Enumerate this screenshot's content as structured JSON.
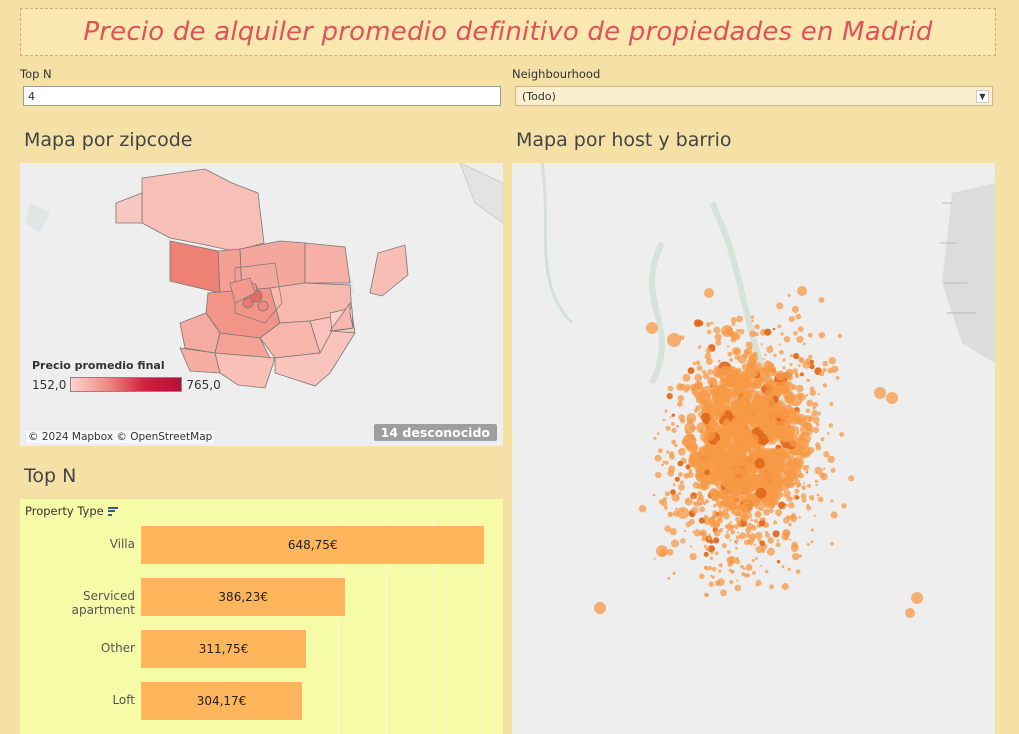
{
  "title": "Precio de alquiler promedio definitivo de propiedades en Madrid",
  "filters": {
    "top_n": {
      "label": "Top N",
      "value": "4"
    },
    "neighbourhood": {
      "label": "Neighbourhood",
      "value": "(Todo)"
    }
  },
  "sections": {
    "zip_map": "Mapa por zipcode",
    "host_map": "Mapa por host y barrio",
    "top_n": "Top N"
  },
  "legend": {
    "title": "Precio promedio final",
    "min": "152,0",
    "max": "765,0"
  },
  "attribution": "© 2024 Mapbox © OpenStreetMap",
  "unknown_badge": "14 desconocido",
  "colors": {
    "background": "#f5e1a6",
    "title": "#e0525b",
    "bar": "#ffb55c",
    "bar_panel": "#f6fba8",
    "dot": "#f79a45"
  },
  "chart_data": {
    "type": "bar",
    "orientation": "horizontal",
    "dimension_label": "Property Type",
    "categories": [
      "Villa",
      "Serviced apartment",
      "Other",
      "Loft"
    ],
    "values": [
      648.75,
      386.23,
      311.75,
      304.17
    ],
    "value_labels": [
      "648,75€",
      "386,23€",
      "311,75€",
      "304,17€"
    ],
    "xlim": [
      0,
      680
    ]
  }
}
